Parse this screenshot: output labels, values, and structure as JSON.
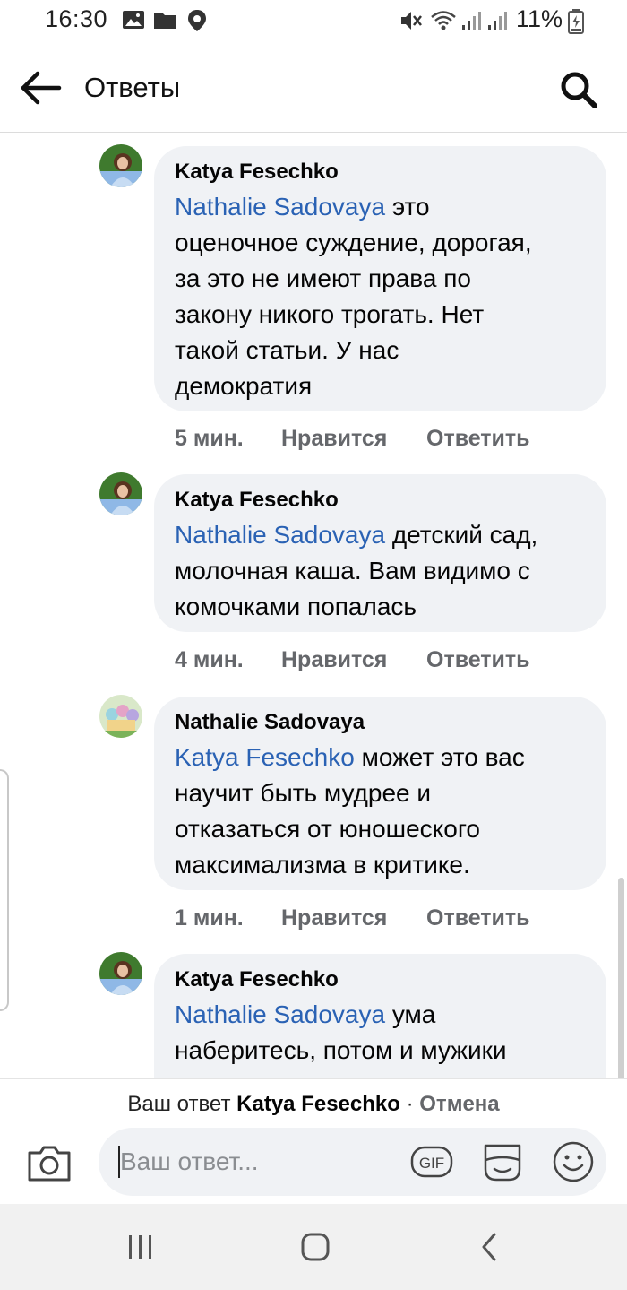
{
  "status_bar": {
    "time": "16:30",
    "battery": "11%",
    "left_icons": [
      "image-icon",
      "folder-icon",
      "location-icon"
    ],
    "right_icons": [
      "mute-icon",
      "wifi-icon",
      "signal-icon",
      "signal-icon",
      "battery-icon"
    ]
  },
  "header": {
    "title": "Ответы"
  },
  "comments": [
    {
      "author": "Katya Fesechko",
      "mention": "Nathalie Sadovaya",
      "lines": [
        "это",
        "оценочное суждение, дорогая,",
        "за это не имеют права по",
        "закону никого трогать. Нет",
        "такой статьи. У нас",
        "демократия"
      ],
      "time": "5 мин.",
      "like": "Нравится",
      "reply": "Ответить"
    },
    {
      "author": "Katya Fesechko",
      "mention": "Nathalie Sadovaya",
      "lines": [
        "детский сад,",
        "молочная каша. Вам видимо с",
        "комочками попалась"
      ],
      "time": "4 мин.",
      "like": "Нравится",
      "reply": "Ответить"
    },
    {
      "author": "Nathalie Sadovaya",
      "mention": "Katya Fesechko",
      "lines": [
        "может это вас",
        "научит быть мудрее и",
        "отказаться от юношеского",
        "максимализма в критике."
      ],
      "time": "1 мин.",
      "like": "Нравится",
      "reply": "Ответить"
    },
    {
      "author": "Katya Fesechko",
      "mention": "Nathalie Sadovaya",
      "lines": [
        "ума",
        "наберитесь, потом и мужики"
      ]
    }
  ],
  "reply_bar": {
    "prefix": "Ваш ответ",
    "target": "Katya Fesechko",
    "separator": "·",
    "cancel": "Отмена",
    "placeholder": "Ваш ответ...",
    "gif_label": "GIF"
  },
  "colors": {
    "mention": "#2a62b4",
    "bubble": "#f0f2f5",
    "meta": "#65676b"
  }
}
